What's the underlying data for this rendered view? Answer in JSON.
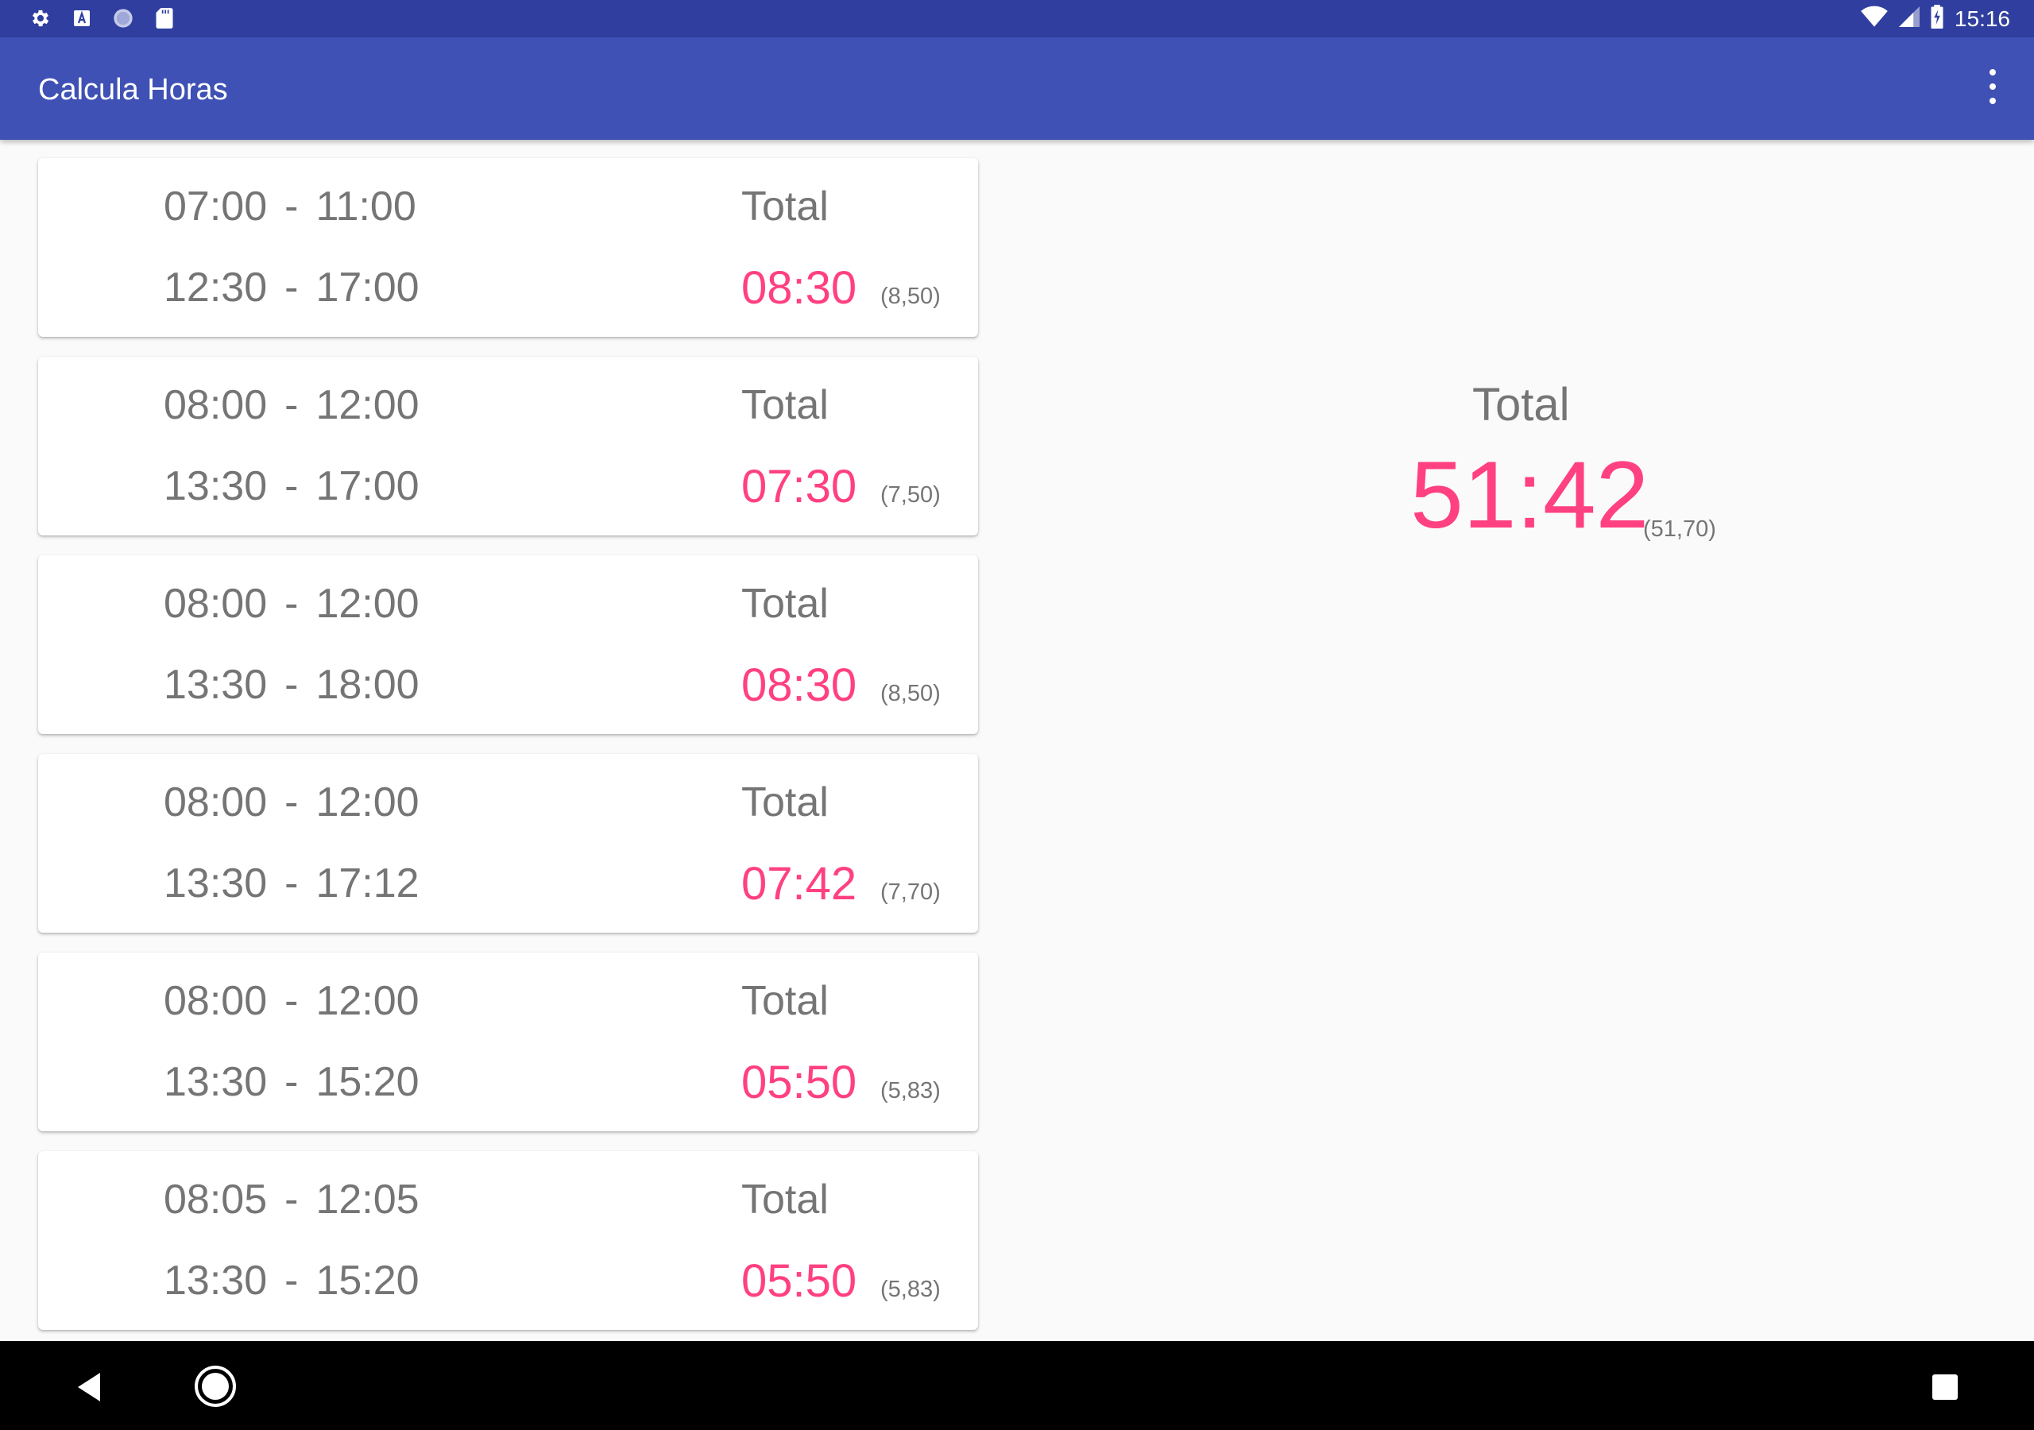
{
  "status_bar": {
    "time": "15:16",
    "left_icons": [
      "settings-icon",
      "a-icon",
      "circle-icon",
      "sd-card-icon"
    ],
    "right_icons": [
      "wifi-icon",
      "signal-icon",
      "battery-charging-icon"
    ]
  },
  "app_bar": {
    "title": "Calcula Horas",
    "menu_icon": "more-vert-icon"
  },
  "entries": [
    {
      "in1": "07:00",
      "out1": "11:00",
      "in2": "12:30",
      "out2": "17:00",
      "total_label": "Total",
      "total": "08:30",
      "decimal": "(8,50)"
    },
    {
      "in1": "08:00",
      "out1": "12:00",
      "in2": "13:30",
      "out2": "17:00",
      "total_label": "Total",
      "total": "07:30",
      "decimal": "(7,50)"
    },
    {
      "in1": "08:00",
      "out1": "12:00",
      "in2": "13:30",
      "out2": "18:00",
      "total_label": "Total",
      "total": "08:30",
      "decimal": "(8,50)"
    },
    {
      "in1": "08:00",
      "out1": "12:00",
      "in2": "13:30",
      "out2": "17:12",
      "total_label": "Total",
      "total": "07:42",
      "decimal": "(7,70)"
    },
    {
      "in1": "08:00",
      "out1": "12:00",
      "in2": "13:30",
      "out2": "15:20",
      "total_label": "Total",
      "total": "05:50",
      "decimal": "(5,83)"
    },
    {
      "in1": "08:05",
      "out1": "12:05",
      "in2": "13:30",
      "out2": "15:20",
      "total_label": "Total",
      "total": "05:50",
      "decimal": "(5,83)"
    }
  ],
  "separator": "-",
  "summary": {
    "label": "Total",
    "value": "51:42",
    "decimal": "(51,70)"
  },
  "nav_bar": {
    "icons": [
      "back-icon",
      "home-icon",
      "recents-icon"
    ]
  },
  "colors": {
    "status_bar": "#303f9f",
    "app_bar": "#3f51b5",
    "accent": "#ff4081",
    "text_secondary": "#757575",
    "background": "#fafafa"
  }
}
